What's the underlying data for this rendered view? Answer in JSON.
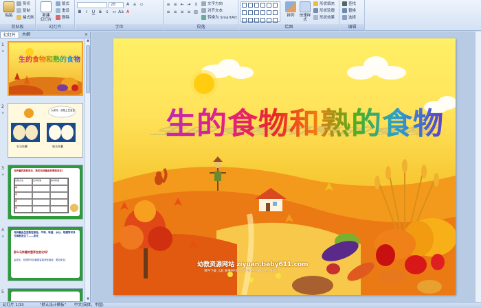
{
  "ribbon": {
    "clipboard": {
      "paste": "粘贴",
      "cut": "剪切",
      "copy": "复制",
      "format_painter": "格式刷",
      "label": "剪贴板"
    },
    "slides": {
      "new_slide": "新建\n幻灯片",
      "layout": "版式",
      "reset": "重设",
      "delete": "删除",
      "label": "幻灯片"
    },
    "font": {
      "font_value": "",
      "size_value": "28",
      "label": "字体"
    },
    "paragraph": {
      "text_direction": "文字方向",
      "align_text": "对齐文本",
      "smartart": "转换为 SmartArt",
      "label": "段落"
    },
    "drawing": {
      "arrange": "排列",
      "quick_styles": "快速样式",
      "fill": "形状填充",
      "outline": "形状轮廓",
      "effects": "形状效果",
      "label": "绘图"
    },
    "editing": {
      "find": "查找",
      "replace": "替换",
      "select": "选择",
      "label": "编辑"
    }
  },
  "panel": {
    "tab_slides": "幻灯片",
    "tab_outline": "大纲",
    "close": "×",
    "thumbs": [
      {
        "num": "1"
      },
      {
        "num": "2",
        "label_a": "生马铃薯",
        "label_b": "熟马铃薯",
        "bubble": "大家好，我是土豆宝宝"
      },
      {
        "num": "3",
        "head": "马铃薯的蒸煮变化，熟的马铃薯会有哪些变化？",
        "col1": "比较方法",
        "col2": "生马铃薯",
        "col3": "熟马铃薯",
        "row1": "看",
        "row2": "闻",
        "row3": "捏",
        "row4": "尝"
      },
      {
        "num": "4",
        "body": "马铃薯由生变熟在颜色、气味、味道、水分、软硬等许多方面都发生了——变化",
        "q": "那么马铃薯的营养会变化吗？",
        "body2": "会变化，但熟的马铃薯更容易消化吸收，更加安全。"
      },
      {
        "num": "5"
      }
    ]
  },
  "slide": {
    "title": "生的食物和熟的食物",
    "site": "幼教资源网站  ziyuan.baby611.com",
    "site_sub": "课件下载   儿歌   故事MP3   FLASH课件下载   试卷下载等"
  },
  "status": {
    "slide_pos": "幻灯片 1/19",
    "theme": "\"默认设计模板\"",
    "lang": "中文(简体，中国)"
  },
  "colors": {
    "ribbon_top": "#eef4fc",
    "ribbon_bottom": "#d4e2f4",
    "selected_border": "#f0a030"
  }
}
